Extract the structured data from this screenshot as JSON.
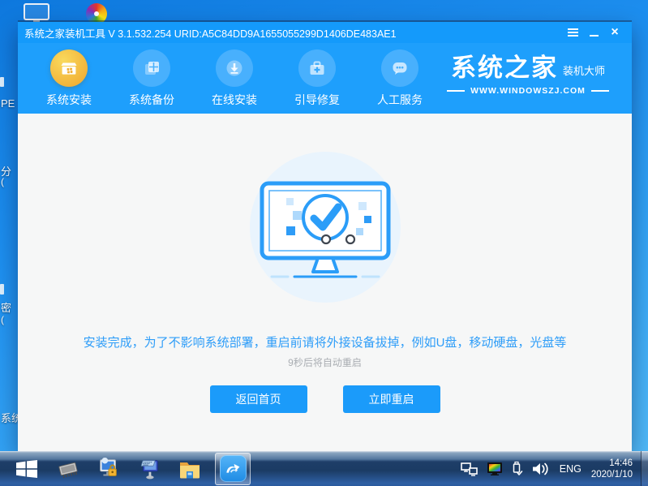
{
  "window": {
    "title": "系统之家装机工具 V 3.1.532.254 URID:A5C84DD9A1655055299D1406DE483AE1",
    "controls": {
      "close": "×"
    }
  },
  "nav": {
    "items": [
      {
        "label": "系统安装",
        "icon": "install-box-icon",
        "active": true
      },
      {
        "label": "系统备份",
        "icon": "backup-copy-icon",
        "active": false
      },
      {
        "label": "在线安装",
        "icon": "download-circle-icon",
        "active": false
      },
      {
        "label": "引导修复",
        "icon": "toolbox-plus-icon",
        "active": false
      },
      {
        "label": "人工服务",
        "icon": "chat-bubble-icon",
        "active": false
      }
    ],
    "logo": {
      "brand": "系统之家",
      "sub": "装机大师",
      "site": "WWW.WINDOWSZJ.COM"
    }
  },
  "main": {
    "message": "安装完成，为了不影响系统部署，重启前请将外接设备拔掉，例如U盘，移动硬盘，光盘等",
    "countdown": "9秒后将自动重启",
    "buttons": [
      {
        "label": "返回首页"
      },
      {
        "label": "立即重启"
      }
    ]
  },
  "desktop": {
    "icon_labels": [
      {
        "text": "PE"
      },
      {
        "text": "分"
      },
      {
        "text": "("
      },
      {
        "text": "密"
      },
      {
        "text": "("
      },
      {
        "text": "系统"
      }
    ]
  },
  "taskbar": {
    "icons": [
      "windows-start-icon",
      "ram-chip-icon",
      "display-lock-icon",
      "keyboard-display-icon",
      "folder-icon",
      "installer-app-icon"
    ],
    "tray": {
      "lang": "ENG",
      "time": "14:46",
      "date": "2020/1/10",
      "icons": [
        "network-icon",
        "display-color-icon",
        "usb-icon",
        "volume-icon"
      ]
    }
  },
  "colors": {
    "titlebar": "#149afb",
    "navbar": "#1e9ffc",
    "accent_gold": "#f2b238",
    "button_blue": "#1b9bfa",
    "message_blue": "#2e9df8",
    "taskbar_navy": "#1d3e68"
  }
}
